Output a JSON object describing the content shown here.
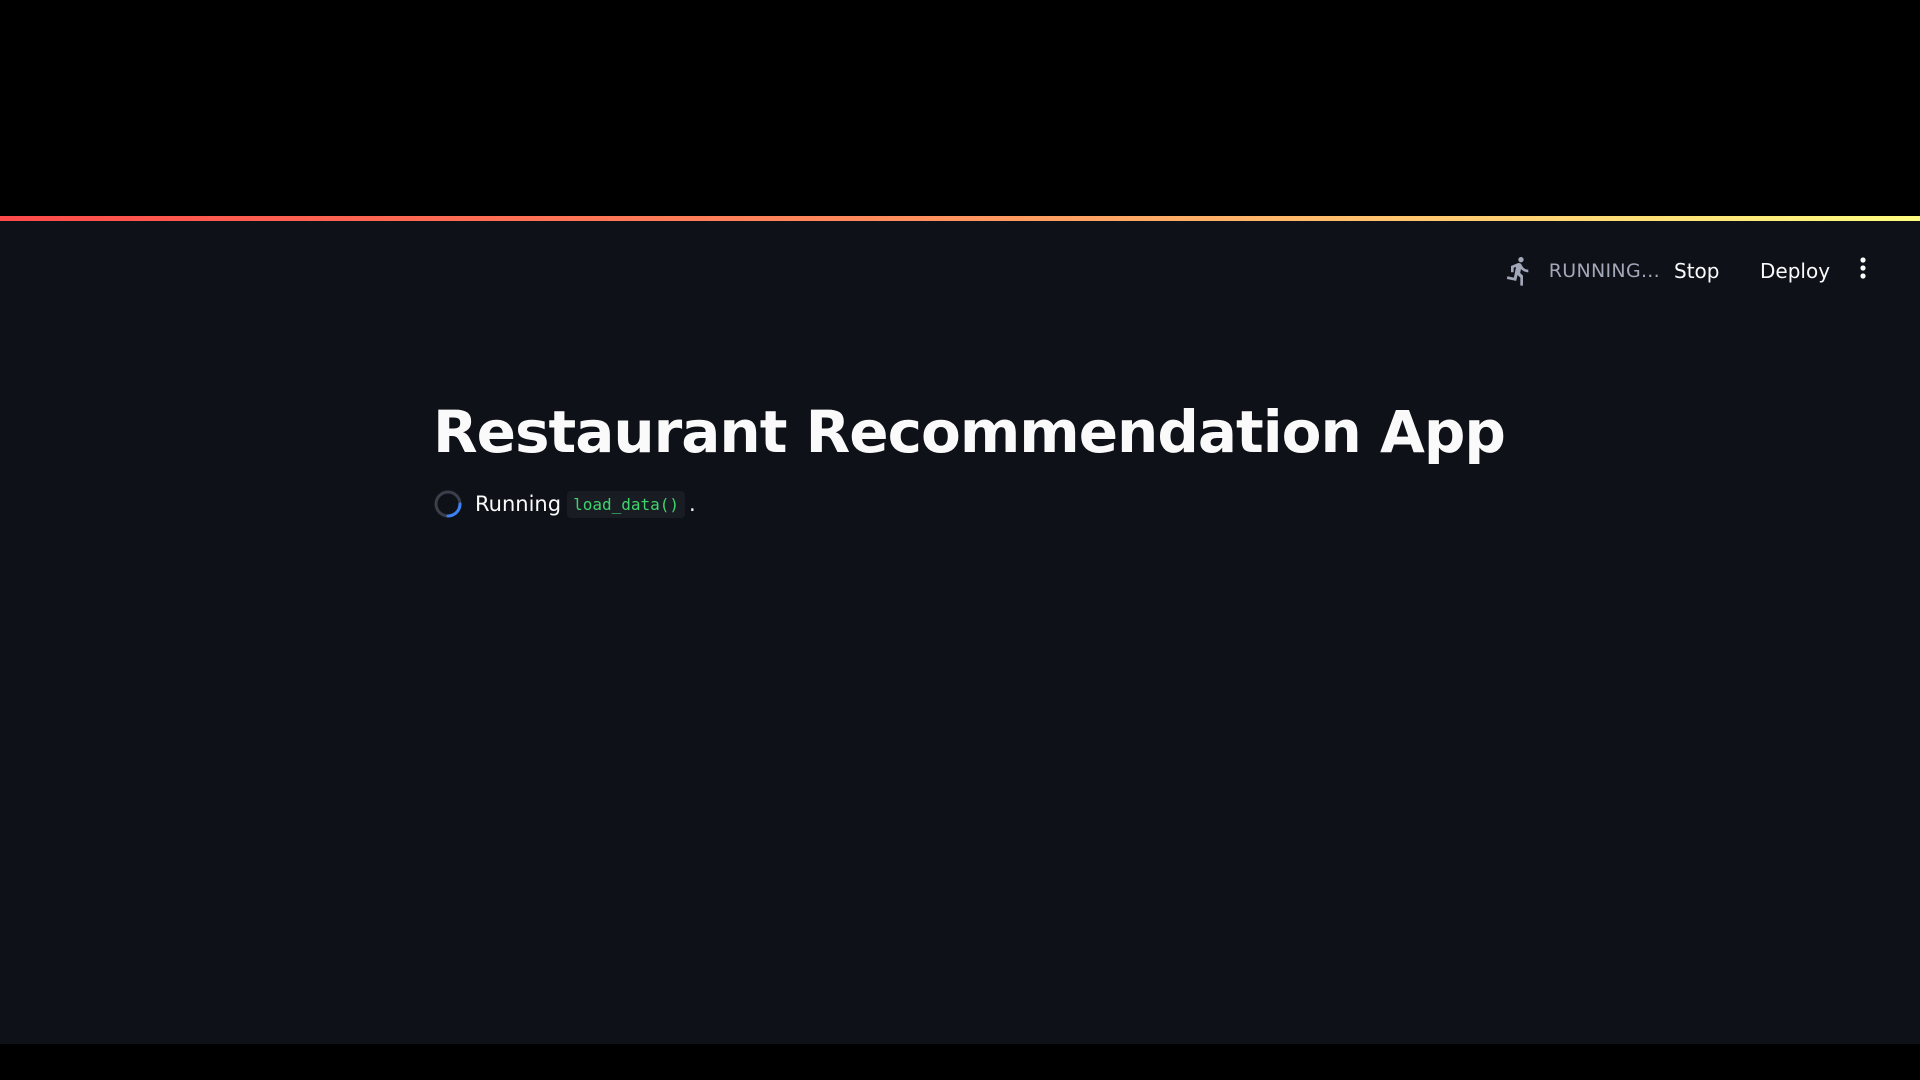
{
  "header": {
    "status_label": "RUNNING...",
    "status_icon": "running-man-icon",
    "stop_label": "Stop",
    "deploy_label": "Deploy",
    "menu_icon": "vertical-ellipsis-icon"
  },
  "main": {
    "title": "Restaurant Recommendation App",
    "spinner": {
      "text": "Running",
      "code": "load_data()",
      "suffix": "."
    }
  },
  "colors": {
    "background": "#0e1117",
    "letterbox": "#000000",
    "text": "#fafafa",
    "status_text": "#a3a8b8",
    "code_text": "#3dd56d",
    "code_bg": "#1a1c24",
    "spinner_accent": "#3b82f6",
    "decoration_start": "#ff4b4b",
    "decoration_end": "#fffd80"
  }
}
